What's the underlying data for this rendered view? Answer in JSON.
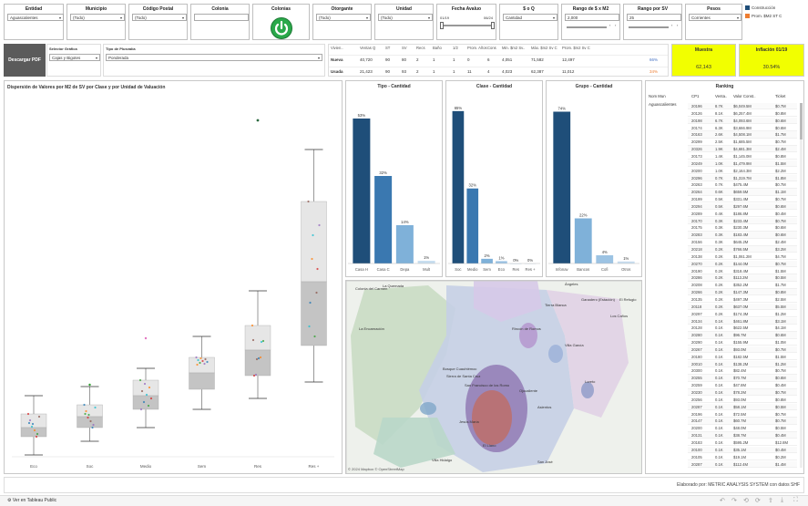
{
  "filters": {
    "entidad": {
      "title": "Entidad",
      "value": "Aguascalientes"
    },
    "municipio": {
      "title": "Municipio",
      "value": "(Todo)"
    },
    "cp": {
      "title": "Código Postal",
      "value": "(Todo)"
    },
    "colonia": {
      "title": "Colonia",
      "value": ""
    },
    "colonias": {
      "title": "Colonias"
    },
    "otorgante": {
      "title": "Otorgante",
      "value": "(Todo)"
    },
    "unidad": {
      "title": "Unidad",
      "value": "(Todo)"
    },
    "fecha": {
      "title": "Fecha Avaluo",
      "from": "01/19",
      "to": "06/24"
    },
    "sq": {
      "title": "$ o Q",
      "value": "Cantidad"
    },
    "rango_m2": {
      "title": "Rango de $ x M2",
      "value": "2,000"
    },
    "rango_sv": {
      "title": "Rango por SV",
      "value": "25"
    },
    "pesos": {
      "title": "Pesos",
      "value": "Corrientes"
    }
  },
  "legend": {
    "items": [
      {
        "label": "Construcción",
        "color": "#1f4e79"
      },
      {
        "label": "Prom. $M2 ST C",
        "color": "#ed7d31"
      }
    ]
  },
  "controls": {
    "pdf_button": "Descargar PDF",
    "selector_grafica": {
      "title": "Selector Gráfica",
      "value": "Cajas y Bigotes"
    },
    "tipo_plusvalia": {
      "title": "Tipo de Plusvalía",
      "value": "Ponderada"
    }
  },
  "stats_table": {
    "headers": [
      "Vivien..",
      "Ventas Q",
      "ST",
      "SV",
      "Recs",
      "Baño",
      "1/2",
      "Prom. Años",
      "Cons",
      "Min. $m2 Sv..",
      "Máx. $m2 Sv C",
      "Prom. $m2 Sv C",
      ""
    ],
    "rows": [
      {
        "cells": [
          "Nueva",
          "40,720",
          "90",
          "80",
          "2",
          "1",
          "1",
          "0",
          "6",
          "4,051",
          "71,582",
          "12,497",
          "66%"
        ],
        "pct_color": "#4472c4"
      },
      {
        "cells": [
          "Usada",
          "21,423",
          "90",
          "93",
          "2",
          "1",
          "1",
          "11",
          "4",
          "4,023",
          "62,387",
          "11,012",
          "34%"
        ],
        "pct_color": "#ed7d31"
      }
    ]
  },
  "kpis": [
    {
      "title": "Muestra",
      "value": "62,143"
    },
    {
      "title": "Inflación 01/19",
      "value": "30.54%"
    }
  ],
  "boxplot": {
    "title": "Dispersión de Valores por M2 de SV  por Clase y por Unidad de Valuación",
    "categories": [
      "Eco",
      "Soc",
      "Medio",
      "Sem",
      "Res",
      "Res +"
    ]
  },
  "chart_data": [
    {
      "type": "bar",
      "title": "Tipo - Cantidad",
      "categories": [
        "Casa H",
        "Casa C",
        "Depa",
        "Mult"
      ],
      "values": [
        53,
        32,
        14,
        1
      ],
      "value_labels": [
        "53%",
        "32%",
        "14%",
        "1%"
      ],
      "colors": [
        "#1f4e79",
        "#3a78b0",
        "#7fb1d9",
        "#c8def0"
      ],
      "ylim": [
        0,
        60
      ]
    },
    {
      "type": "bar",
      "title": "Clase - Cantidad",
      "categories": [
        "Soc",
        "Medio",
        "Sem",
        "Eco",
        "Res",
        "Res +"
      ],
      "values": [
        65,
        32,
        2,
        1,
        0,
        0
      ],
      "value_labels": [
        "65%",
        "32%",
        "2%",
        "1%",
        "0%",
        "0%"
      ],
      "colors": [
        "#1f4e79",
        "#3a78b0",
        "#7fb1d9",
        "#9cc3e3",
        "#c8def0",
        "#dce9f5"
      ],
      "ylim": [
        0,
        70
      ]
    },
    {
      "type": "bar",
      "title": "Grupo - Cantidad",
      "categories": [
        "Infonav",
        "Bancos",
        "Cofi",
        "Otros"
      ],
      "values": [
        74,
        22,
        4,
        1
      ],
      "value_labels": [
        "74%",
        "22%",
        "4%",
        "1%"
      ],
      "colors": [
        "#1f4e79",
        "#7fb1d9",
        "#9cc3e3",
        "#c8def0"
      ],
      "ylim": [
        0,
        80
      ]
    }
  ],
  "map": {
    "credit": "© 2024 Mapbox  © OpenStreetMap",
    "labels": [
      "Colonia del Carmen",
      "La Quemada",
      "Ángeles",
      "El Refugio",
      "Tierra Blanca",
      "Ganadero (Estación)",
      "Los Caños",
      "La Encarnación",
      "Villa García",
      "Rincón de Romos",
      "Loreto",
      "Bosque Cuauhtémoc",
      "Sierra de Santa Cruz",
      "Ojocaliente",
      "San Francisco de los Romo",
      "Asientos",
      "Jesús María",
      "Villa Hidalgo",
      "El Llano",
      "San José"
    ]
  },
  "ranking": {
    "title": "Ranking",
    "headers": [
      "Nom Mun",
      "CP1",
      "Venta..",
      "Valor Const..",
      "Ticket"
    ],
    "municipio": "Aguascalientes",
    "rows": [
      [
        "20196",
        "8.7K",
        "$6,049.5M",
        "$0.7M"
      ],
      [
        "20126",
        "8.1K",
        "$6,257.4M",
        "$0.8M"
      ],
      [
        "20198",
        "6.7K",
        "$4,093.6M",
        "$0.6M"
      ],
      [
        "20174",
        "6.3K",
        "$3,666.9M",
        "$0.6M"
      ],
      [
        "20163",
        "2.6K",
        "$4,508.1M",
        "$1.7M"
      ],
      [
        "20299",
        "2.5K",
        "$1,685.5M",
        "$0.7M"
      ],
      [
        "20326",
        "1.9K",
        "$4,681.3M",
        "$2.4M"
      ],
      [
        "20173",
        "1.4K",
        "$1,145.0M",
        "$0.8M"
      ],
      [
        "20249",
        "1.0K",
        "$1,479.9M",
        "$1.5M"
      ],
      [
        "20200",
        "1.0K",
        "$2,164.3M",
        "$2.2M"
      ],
      [
        "20296",
        "0.7K",
        "$1,319.7M",
        "$1.8M"
      ],
      [
        "20263",
        "0.7K",
        "$475.4M",
        "$0.7M"
      ],
      [
        "20264",
        "0.6K",
        "$659.5M",
        "$1.1M"
      ],
      [
        "20199",
        "0.5K",
        "$331.4M",
        "$0.7M"
      ],
      [
        "20294",
        "0.5K",
        "$297.6M",
        "$0.6M"
      ],
      [
        "20289",
        "0.4K",
        "$186.8M",
        "$0.4M"
      ],
      [
        "20170",
        "0.3K",
        "$233.4M",
        "$0.7M"
      ],
      [
        "20175",
        "0.3K",
        "$230.3M",
        "$0.6M"
      ],
      [
        "20283",
        "0.3K",
        "$183.4M",
        "$0.6M"
      ],
      [
        "20156",
        "0.3K",
        "$645.2M",
        "$2.4M"
      ],
      [
        "20218",
        "0.2K",
        "$766.5M",
        "$3.2M"
      ],
      [
        "20138",
        "0.2K",
        "$1,061.2M",
        "$4.7M"
      ],
      [
        "20270",
        "0.2K",
        "$144.0M",
        "$0.7M"
      ],
      [
        "20190",
        "0.2K",
        "$318.4M",
        "$1.5M"
      ],
      [
        "20286",
        "0.2K",
        "$113.2M",
        "$0.5M"
      ],
      [
        "20208",
        "0.2K",
        "$352.2M",
        "$1.7M"
      ],
      [
        "20266",
        "0.2K",
        "$147.3M",
        "$0.8M"
      ],
      [
        "20135",
        "0.2K",
        "$497.3M",
        "$2.5M"
      ],
      [
        "20118",
        "0.2K",
        "$637.0M",
        "$5.5M"
      ],
      [
        "20297",
        "0.2K",
        "$174.3M",
        "$1.2M"
      ],
      [
        "20134",
        "0.1K",
        "$461.8M",
        "$3.1M"
      ],
      [
        "20128",
        "0.1K",
        "$622.5M",
        "$4.1M"
      ],
      [
        "20280",
        "0.1K",
        "$96.7M",
        "$0.6M"
      ],
      [
        "20290",
        "0.1K",
        "$155.9M",
        "$1.0M"
      ],
      [
        "20267",
        "0.1K",
        "$93.0M",
        "$0.7M"
      ],
      [
        "20180",
        "0.1K",
        "$182.5M",
        "$1.5M"
      ],
      [
        "20010",
        "0.1K",
        "$138.2M",
        "$1.2M"
      ],
      [
        "20300",
        "0.1K",
        "$82.4M",
        "$0.7M"
      ],
      [
        "20255",
        "0.1K",
        "$70.7M",
        "$0.6M"
      ],
      [
        "20259",
        "0.1K",
        "$47.8M",
        "$0.4M"
      ],
      [
        "20230",
        "0.1K",
        "$78.2M",
        "$0.7M"
      ],
      [
        "20256",
        "0.1K",
        "$93.0M",
        "$0.8M"
      ],
      [
        "20287",
        "0.1K",
        "$58.1M",
        "$0.5M"
      ],
      [
        "20196",
        "0.1K",
        "$72.5M",
        "$0.7M"
      ],
      [
        "20147",
        "0.1K",
        "$60.7M",
        "$0.7M"
      ],
      [
        "20200",
        "0.1K",
        "$48.0M",
        "$0.5M"
      ],
      [
        "20131",
        "0.1K",
        "$38.7M",
        "$0.4M"
      ],
      [
        "20183",
        "0.1K",
        "$595.2M",
        "$12.8M"
      ],
      [
        "20100",
        "0.1K",
        "$35.1M",
        "$0.4M"
      ],
      [
        "20105",
        "0.1K",
        "$19.1M",
        "$0.2M"
      ],
      [
        "20287",
        "0.1K",
        "$112.4M",
        "$1.4M"
      ]
    ]
  },
  "footer": {
    "credit": "Elaborado por: METRIC ANALYSIS SYSTEM con datos SHF",
    "tableau_link": "Ver en Tableau Public"
  },
  "colors": {
    "kpi_bg": "#f2ff00",
    "pdf_bg": "#5b5b5b",
    "dark_bar": "#1f4e79",
    "power_green": "#2aa84a"
  }
}
